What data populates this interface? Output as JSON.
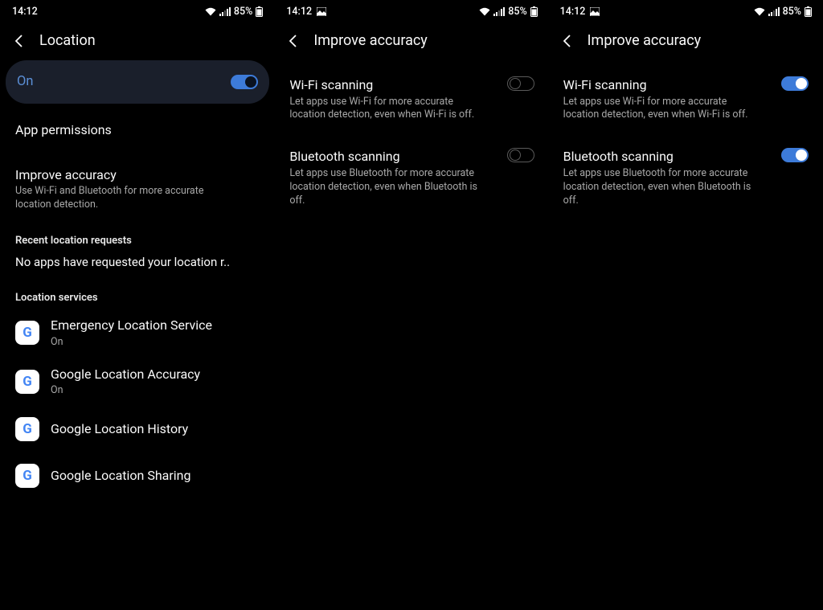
{
  "status": {
    "time": "14:12",
    "battery": "85%"
  },
  "screen1": {
    "title": "Location",
    "master": {
      "label": "On",
      "state": "on"
    },
    "appPermissions": "App permissions",
    "improveAccuracy": {
      "title": "Improve accuracy",
      "subtitle": "Use Wi-Fi and Bluetooth for more accurate location detection."
    },
    "recentLabel": "Recent location requests",
    "recentText": "No apps have requested your location r..",
    "servicesLabel": "Location services",
    "services": [
      {
        "title": "Emergency Location Service",
        "subtitle": "On"
      },
      {
        "title": "Google Location Accuracy",
        "subtitle": "On"
      },
      {
        "title": "Google Location History",
        "subtitle": ""
      },
      {
        "title": "Google Location Sharing",
        "subtitle": ""
      }
    ]
  },
  "screen2": {
    "title": "Improve accuracy",
    "wifi": {
      "title": "Wi-Fi scanning",
      "subtitle": "Let apps use Wi-Fi for more accurate location detection, even when Wi-Fi is off.",
      "state": "off"
    },
    "bluetooth": {
      "title": "Bluetooth scanning",
      "subtitle": "Let apps use Bluetooth for more accurate location detection, even when Bluetooth is off.",
      "state": "off"
    }
  },
  "screen3": {
    "title": "Improve accuracy",
    "wifi": {
      "title": "Wi-Fi scanning",
      "subtitle": "Let apps use Wi-Fi for more accurate location detection, even when Wi-Fi is off.",
      "state": "on"
    },
    "bluetooth": {
      "title": "Bluetooth scanning",
      "subtitle": "Let apps use Bluetooth for more accurate location detection, even when Bluetooth is off.",
      "state": "on"
    }
  }
}
